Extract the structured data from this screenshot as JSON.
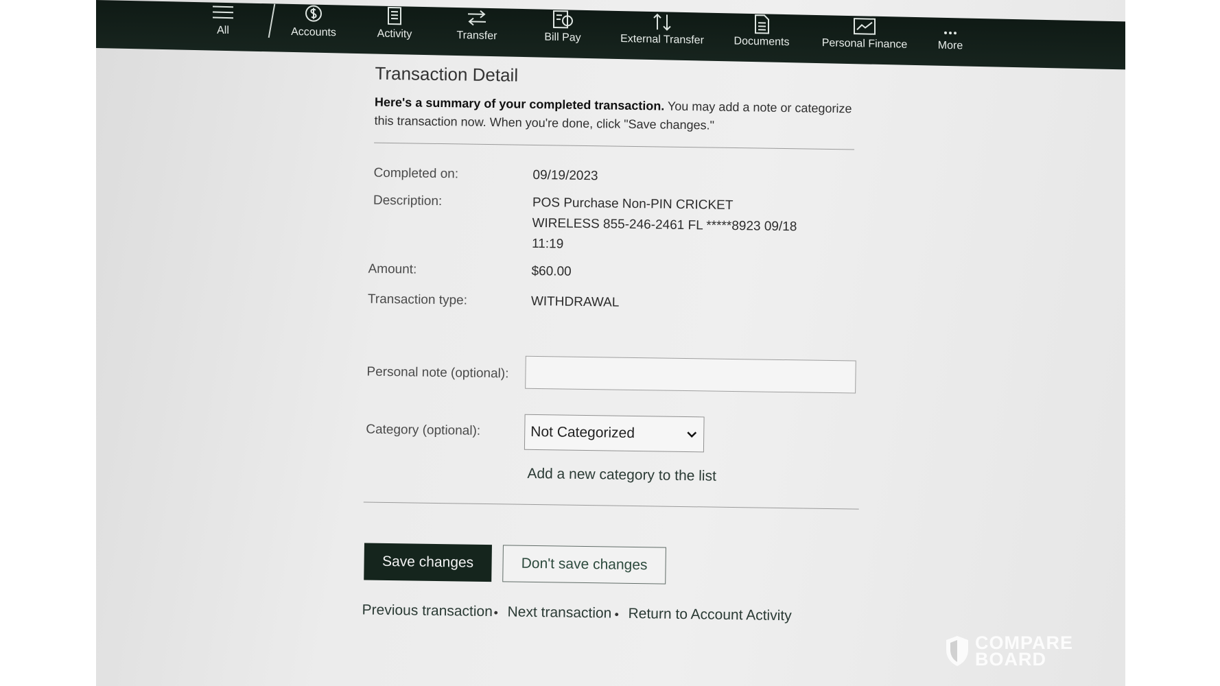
{
  "nav": {
    "all": "All",
    "accounts": "Accounts",
    "activity": "Activity",
    "transfer": "Transfer",
    "bill_pay": "Bill Pay",
    "external_transfer": "External Transfer",
    "documents": "Documents",
    "personal_finance": "Personal Finance",
    "more": "More"
  },
  "page": {
    "title": "Transaction Detail",
    "intro_bold": "Here's a summary of your completed transaction.",
    "intro_rest": " You may add a note or categorize this transaction now. When you're done, click \"Save changes.\""
  },
  "details": {
    "completed_label": "Completed on:",
    "completed_value": "09/19/2023",
    "description_label": "Description:",
    "description_lines": [
      "POS Purchase Non-PIN CRICKET",
      "WIRELESS 855-246-2461 FL *****8923 09/18",
      "11:19"
    ],
    "amount_label": "Amount:",
    "amount_value": "$60.00",
    "type_label": "Transaction type:",
    "type_value": "WITHDRAWAL"
  },
  "form": {
    "note_label": "Personal note (optional):",
    "note_value": "",
    "category_label": "Category (optional):",
    "category_selected": "Not Categorized",
    "add_category_link": "Add a new category to the list"
  },
  "actions": {
    "save": "Save changes",
    "dont_save": "Don't save changes"
  },
  "footer_links": {
    "previous": "Previous transaction",
    "next": "Next transaction",
    "return": "Return to Account Activity",
    "separator": "•"
  },
  "watermark": {
    "line1": "COMPARE",
    "line2": "BOARD"
  },
  "colors": {
    "nav_bg": "#17241e",
    "primary_button": "#15251d"
  }
}
